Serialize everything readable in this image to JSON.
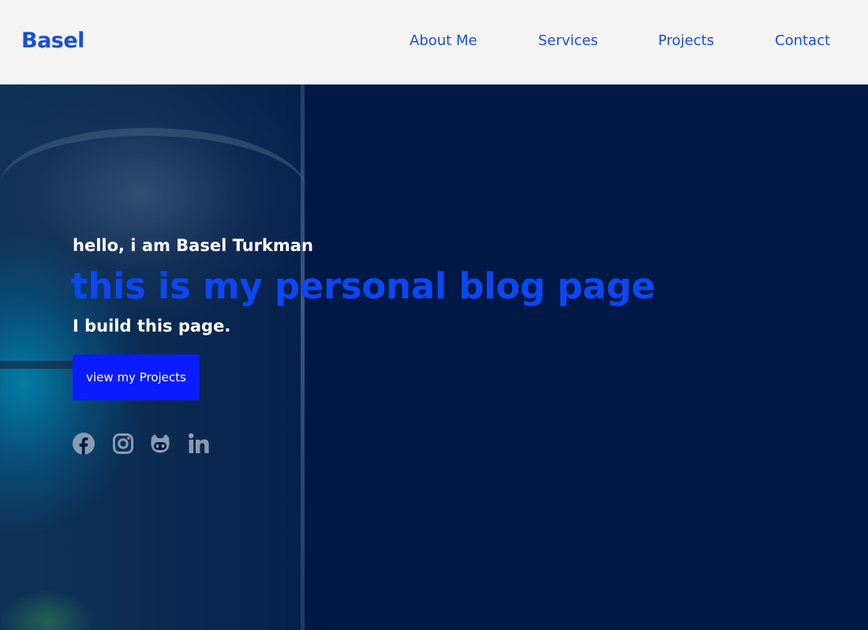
{
  "brand": {
    "name": "Basel"
  },
  "nav": {
    "items": [
      {
        "label": "About Me"
      },
      {
        "label": "Services"
      },
      {
        "label": "Projects"
      },
      {
        "label": "Contact"
      }
    ]
  },
  "hero": {
    "intro": "hello, i am Basel Turkman",
    "headline": "this is my personal blog page",
    "subline": "I build this page.",
    "cta_label": "view my Projects"
  },
  "socials": [
    {
      "icon": "facebook-icon"
    },
    {
      "icon": "instagram-icon"
    },
    {
      "icon": "github-icon"
    },
    {
      "icon": "linkedin-icon"
    }
  ],
  "colors": {
    "accent": "#0d47f0",
    "nav_text": "#1a4fd6",
    "cta_bg": "#0a1cff",
    "hero_bg": "#001845",
    "navbar_bg": "#f4f4f4",
    "social_icon": "#8a9bb0"
  }
}
